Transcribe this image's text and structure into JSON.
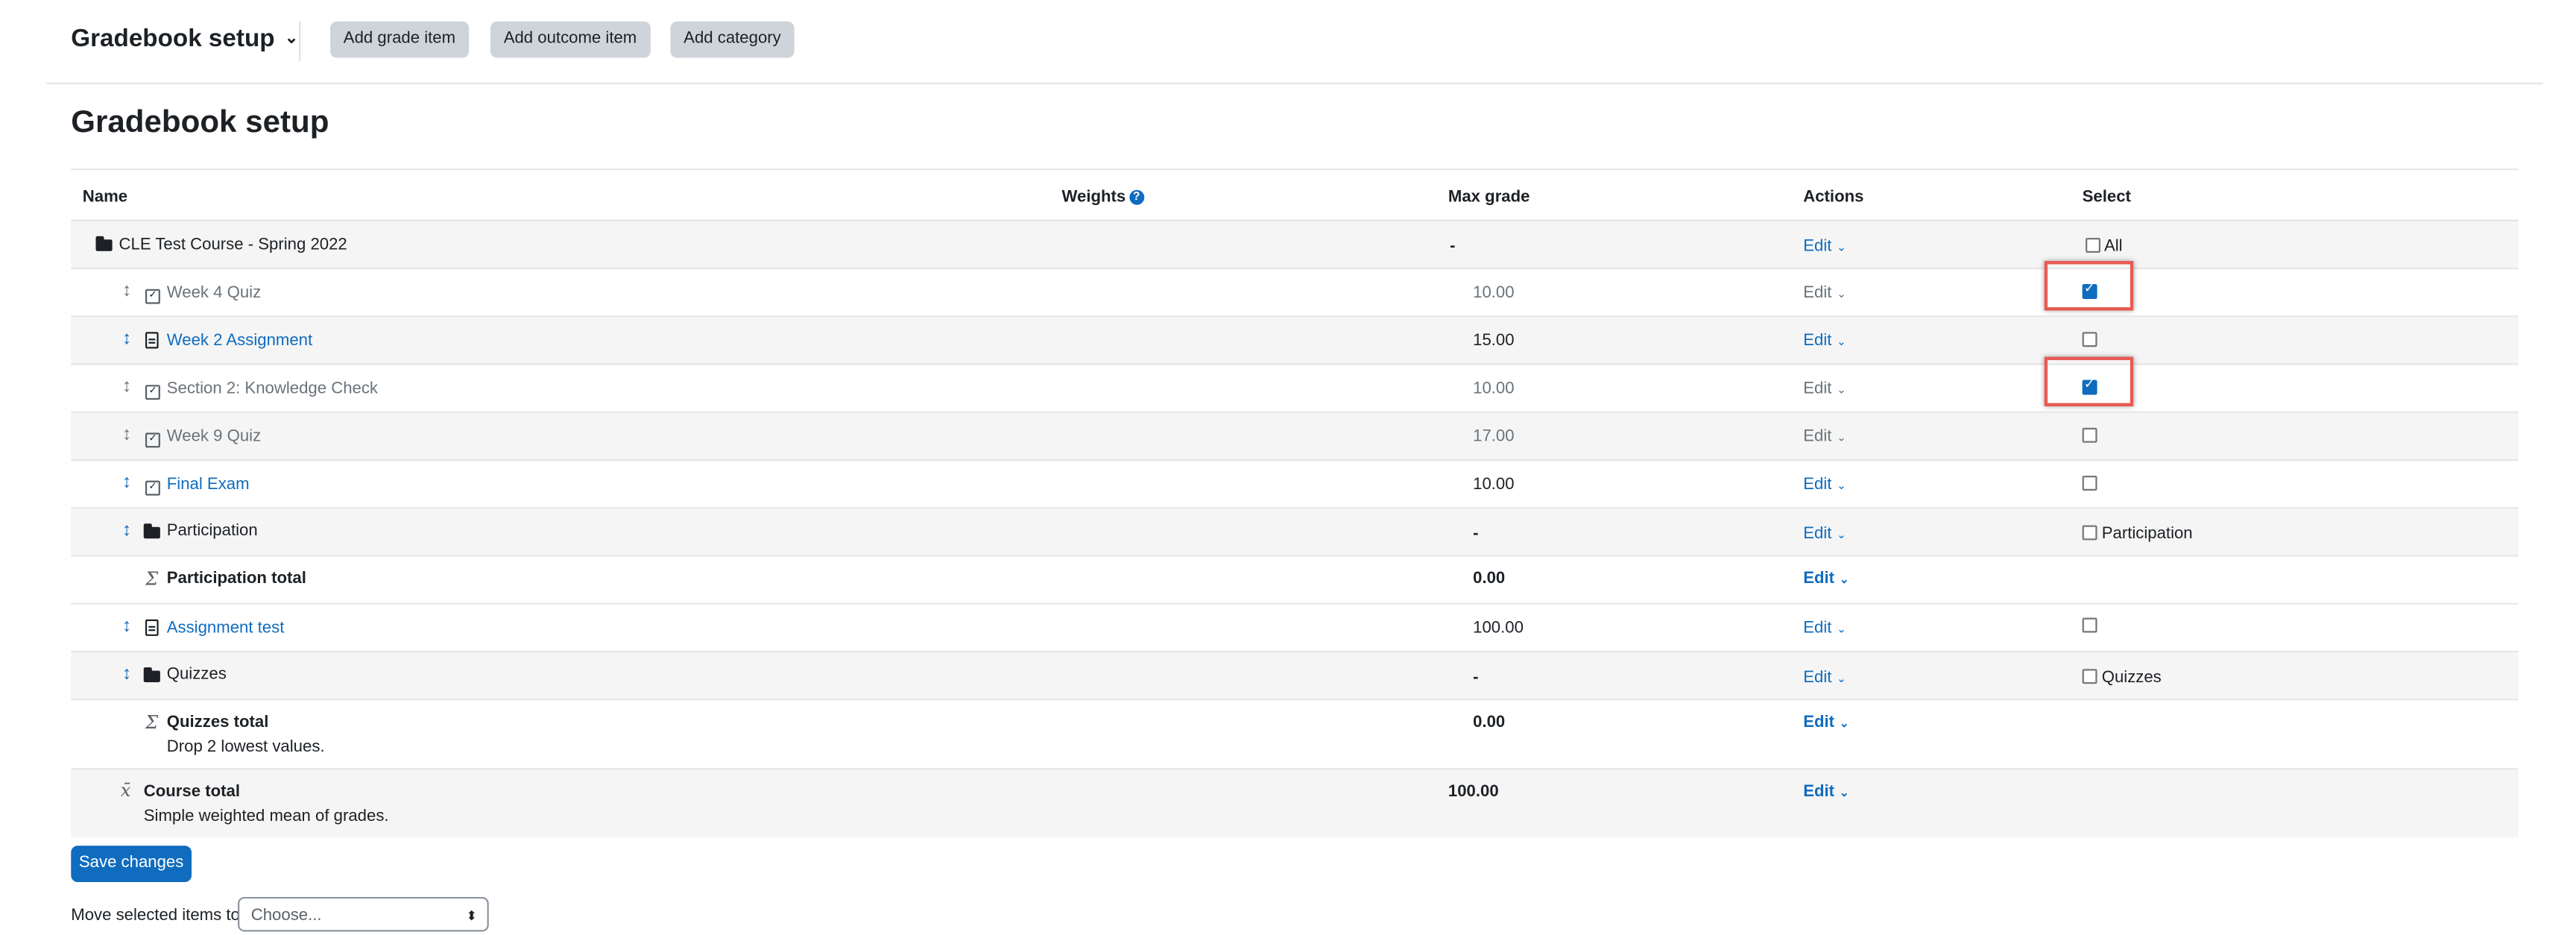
{
  "topbar": {
    "title": "Gradebook setup",
    "caret": "⌄",
    "buttons": [
      "Add grade item",
      "Add outcome item",
      "Add category"
    ]
  },
  "page_title": "Gradebook setup",
  "columns": {
    "name": "Name",
    "weights": "Weights",
    "max_grade": "Max grade",
    "actions": "Actions",
    "select": "Select"
  },
  "weights_help_icon": "question-circle-icon",
  "edit_label": "Edit",
  "caret_small": "⌄",
  "rows": [
    {
      "name": "CLE Test Course - Spring 2022",
      "max": "-",
      "select": "All"
    },
    {
      "name": "Week 4 Quiz",
      "max": "10.00"
    },
    {
      "name": "Week 2 Assignment",
      "max": "15.00"
    },
    {
      "name": "Section 2: Knowledge Check",
      "max": "10.00"
    },
    {
      "name": "Week 9 Quiz",
      "max": "17.00"
    },
    {
      "name": "Final Exam",
      "max": "10.00"
    },
    {
      "name": "Participation",
      "max": "-",
      "select": "Participation"
    },
    {
      "name": "Participation total",
      "max": "0.00"
    },
    {
      "name": "Assignment test",
      "max": "100.00"
    },
    {
      "name": "Quizzes",
      "max": "-",
      "select": "Quizzes"
    },
    {
      "name": "Quizzes total",
      "sub": "Drop 2 lowest values.",
      "max": "0.00"
    },
    {
      "name": "Course total",
      "sub": "Simple weighted mean of grades.",
      "max": "100.00"
    }
  ],
  "selected": {
    "week4_quiz": true,
    "week2_assignment": false,
    "section2_knowledge_check": true,
    "week9_quiz": false,
    "final_exam": false,
    "assignment_test": false
  },
  "save_button": "Save changes",
  "move": {
    "label": "Move selected items to",
    "placeholder": "Choose...",
    "arrow": "⬍"
  },
  "colors": {
    "accent": "#0f6cbf",
    "highlight": "#e85a52",
    "button_grey": "#ced4da"
  },
  "icons": {
    "category": "folder-icon",
    "quiz": "checkbox-square-icon",
    "assignment": "file-icon",
    "sum": "sigma-icon",
    "mean": "mean-icon",
    "move": "move-vertical-icon"
  }
}
